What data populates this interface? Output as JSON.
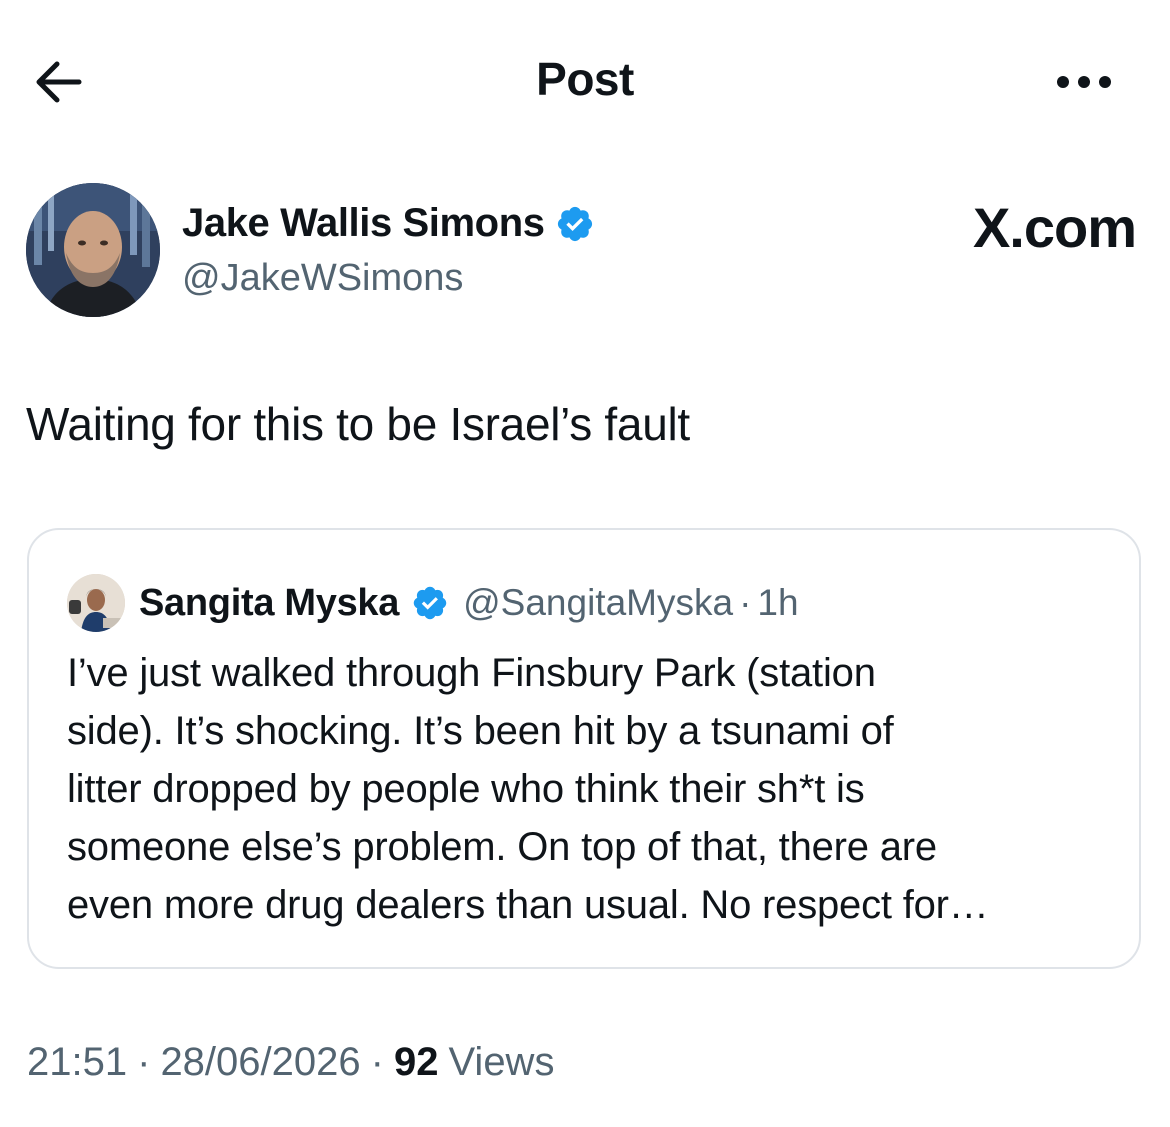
{
  "header": {
    "title": "Post"
  },
  "post": {
    "author_name": "Jake Wallis Simons",
    "author_handle": "@JakeWSimons",
    "site_label": "X.com",
    "text": "Waiting for this to be Israel’s fault"
  },
  "quote": {
    "author_name": "Sangita Myska",
    "author_handle": "@SangitaMyska",
    "separator": "·",
    "time": "1h",
    "lines": [
      "I’ve just walked through Finsbury Park (station",
      "side).  It’s shocking. It’s been hit by a tsunami of",
      "litter dropped by people who think their sh*t is",
      "someone else’s problem. On top of that, there are",
      "even more drug dealers than usual. No respect for…"
    ]
  },
  "meta": {
    "time": "21:51",
    "separator": "·",
    "date": "28/06/2026",
    "views_count": "92",
    "views_label": "Views"
  },
  "colors": {
    "verified": "#1d9bf0",
    "secondary_text": "#536471",
    "border": "#dfe3e8"
  },
  "icons": {
    "back": "arrow-left-icon",
    "more": "more-horizontal-icon",
    "verified": "verified-badge-icon"
  }
}
